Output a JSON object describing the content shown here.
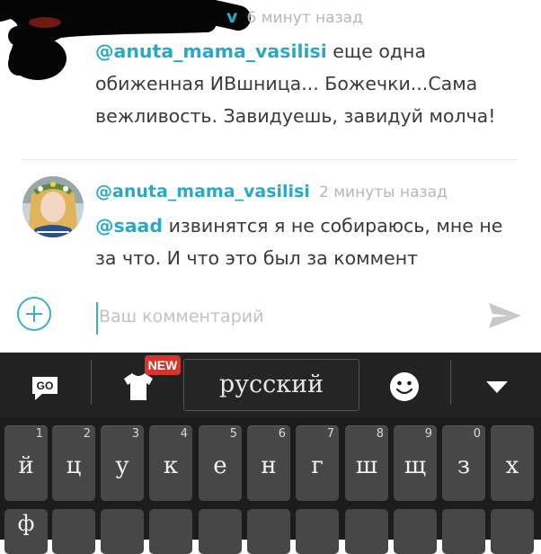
{
  "comments": [
    {
      "username": "v",
      "time": "6 минут назад",
      "mention": "@anuta_mama_vasilisi",
      "line1_rest": " еще одна",
      "line2": "обиженная ИВшница... Божечки...Сама",
      "line3": "вежливость. Завидуешь, завидуй молча!"
    },
    {
      "username": "@anuta_mama_vasilisi",
      "time": "2 минуты назад",
      "mention": "@saad",
      "line1_rest": " извинятся я не собираюсь, мне не",
      "line2": "за что. И что это был за коммент"
    }
  ],
  "input": {
    "placeholder": "Ваш комментарий",
    "value": ""
  },
  "keyboard": {
    "go_label": "GO",
    "new_badge": "NEW",
    "language": "русский",
    "row1": [
      {
        "char": "й",
        "hint": "1"
      },
      {
        "char": "ц",
        "hint": "2"
      },
      {
        "char": "у",
        "hint": "3"
      },
      {
        "char": "к",
        "hint": "4"
      },
      {
        "char": "е",
        "hint": "5"
      },
      {
        "char": "н",
        "hint": "6"
      },
      {
        "char": "г",
        "hint": "7"
      },
      {
        "char": "ш",
        "hint": "8"
      },
      {
        "char": "щ",
        "hint": "9"
      },
      {
        "char": "з",
        "hint": "0"
      },
      {
        "char": "х",
        "hint": ""
      }
    ],
    "row2_first": "ф"
  },
  "colors": {
    "accent": "#2ba9c4",
    "keyboard_bg": "#1c1c1c",
    "key_bg": "#474747",
    "badge": "#d8342b"
  }
}
